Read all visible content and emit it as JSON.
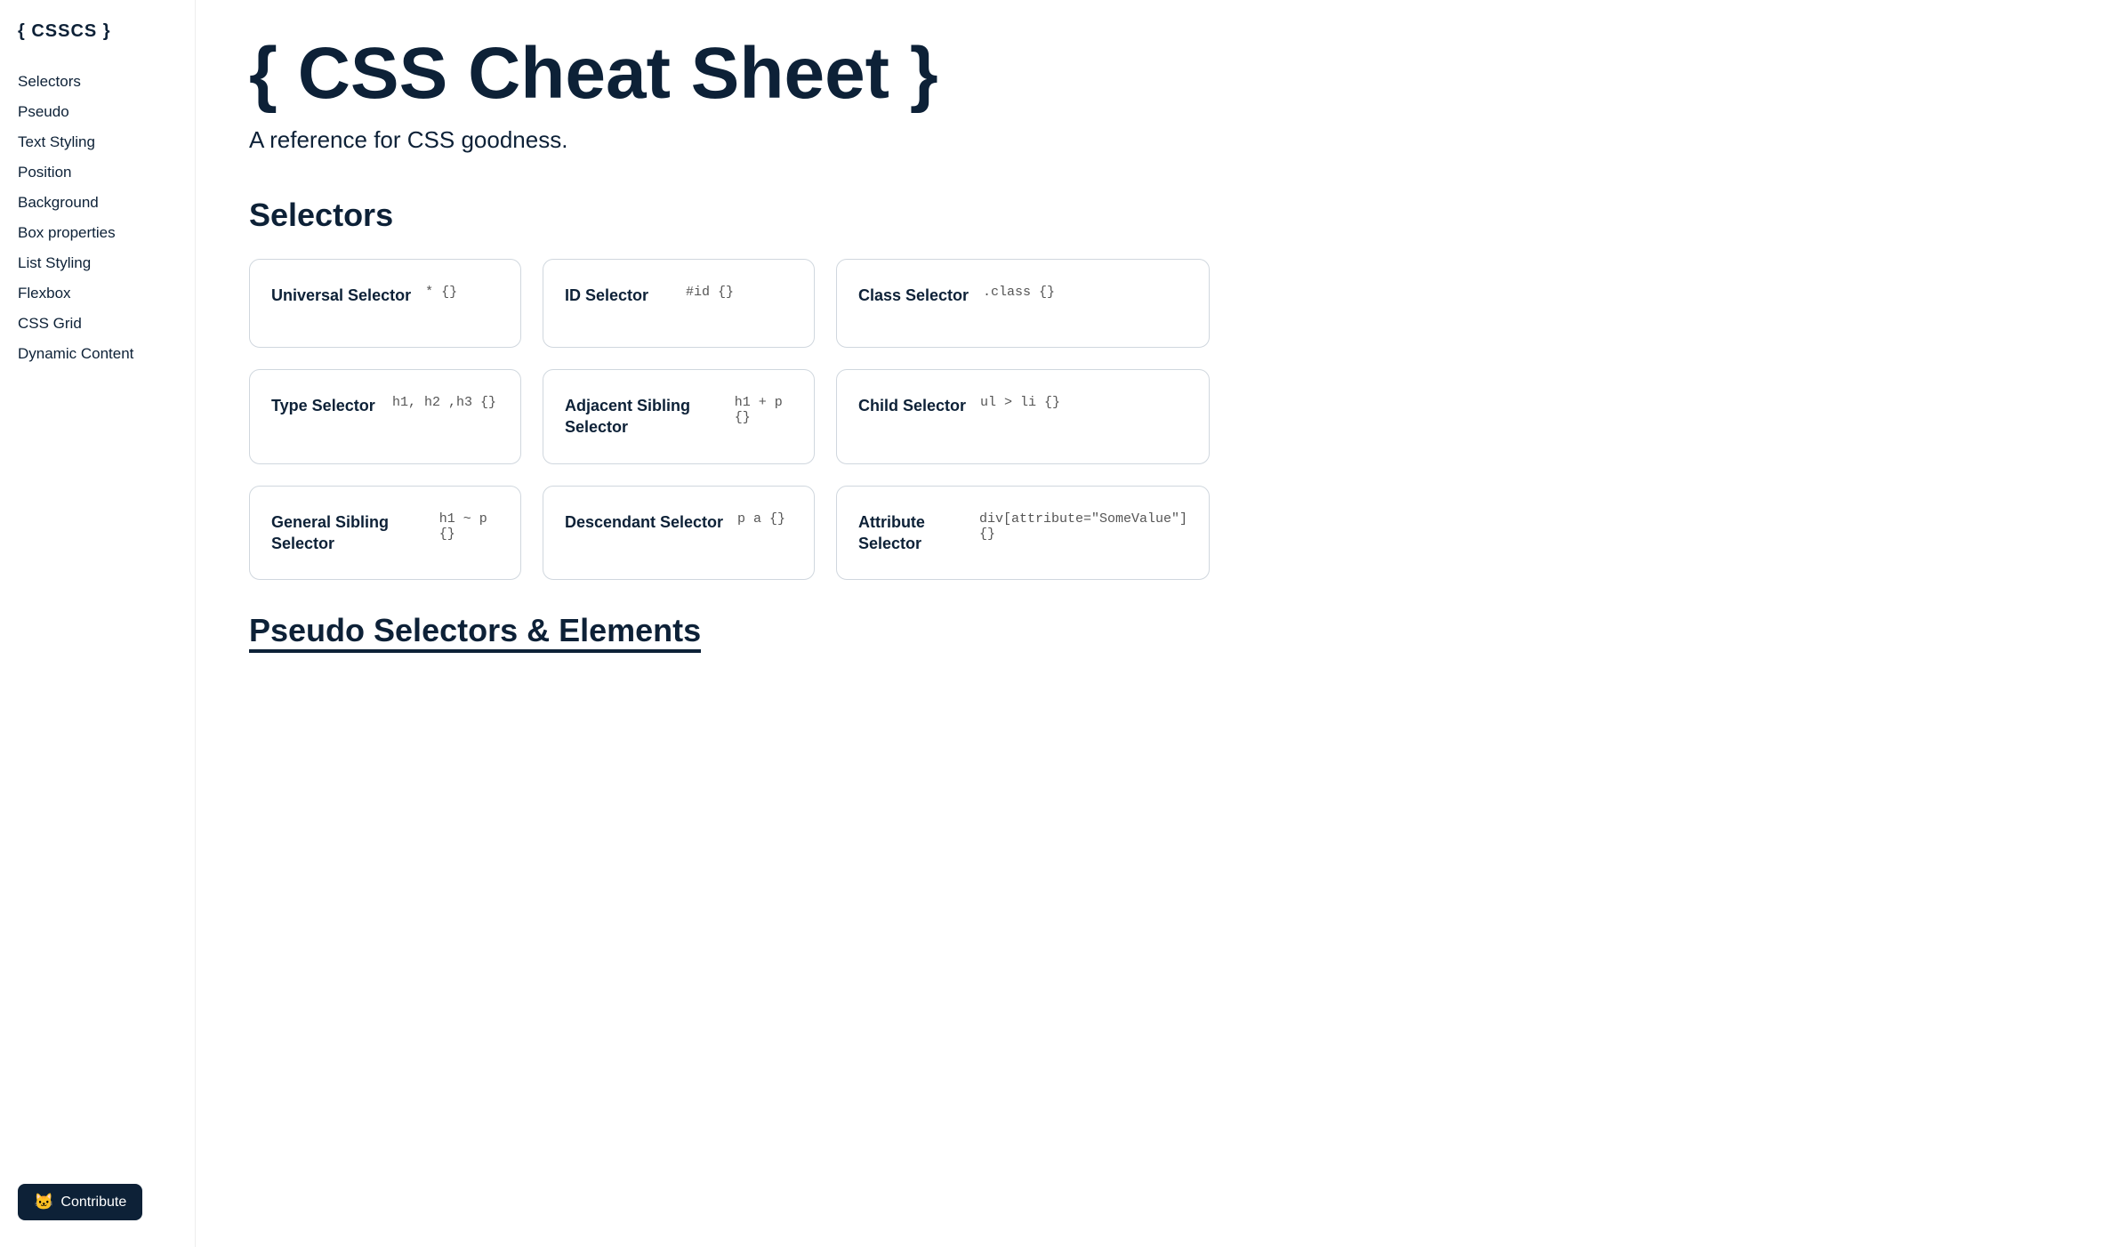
{
  "sidebar": {
    "logo": "{ CSSCS }",
    "nav_items": [
      {
        "label": "Selectors",
        "href": "#selectors"
      },
      {
        "label": "Pseudo",
        "href": "#pseudo"
      },
      {
        "label": "Text Styling",
        "href": "#text-styling"
      },
      {
        "label": "Position",
        "href": "#position"
      },
      {
        "label": "Background",
        "href": "#background"
      },
      {
        "label": "Box properties",
        "href": "#box-properties"
      },
      {
        "label": "List Styling",
        "href": "#list-styling"
      },
      {
        "label": "Flexbox",
        "href": "#flexbox"
      },
      {
        "label": "CSS Grid",
        "href": "#css-grid"
      },
      {
        "label": "Dynamic Content",
        "href": "#dynamic-content"
      }
    ],
    "contribute_btn": "Contribute"
  },
  "main": {
    "title": "{ CSS Cheat Sheet }",
    "subtitle": "A reference for CSS goodness.",
    "sections": [
      {
        "id": "selectors",
        "title": "Selectors",
        "cards": [
          {
            "title": "Universal Selector",
            "code": [
              "* {}"
            ]
          },
          {
            "title": "ID Selector",
            "code": [
              "#id {}"
            ]
          },
          {
            "title": "Class Selector",
            "code": [
              ".class {}"
            ]
          },
          {
            "title": "Type Selector",
            "code": [
              "h1, h2 ,h3 {}"
            ]
          },
          {
            "title": "Adjacent Sibling Selector",
            "code": [
              "h1 + p {}"
            ]
          },
          {
            "title": "Child Selector",
            "code": [
              "ul > li {}"
            ]
          },
          {
            "title": "General Sibling Selector",
            "code": [
              "h1 ~ p {}"
            ]
          },
          {
            "title": "Descendant Selector",
            "code": [
              "p a {}"
            ]
          },
          {
            "title": "Attribute Selector",
            "code": [
              "div[attribute=\"SomeValue\"] {}"
            ]
          }
        ]
      }
    ],
    "pseudo_section_title": "Pseudo Selectors & Elements"
  }
}
